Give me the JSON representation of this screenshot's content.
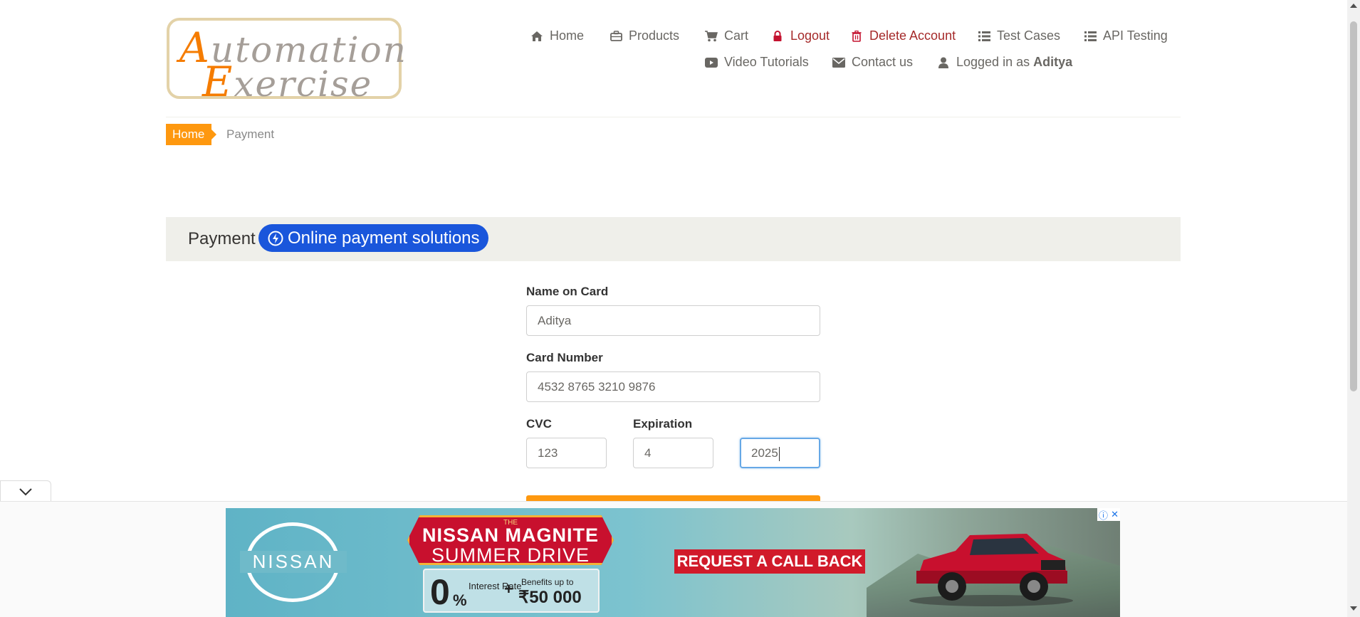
{
  "logo": {
    "line1_cap": "A",
    "line1_rest": "utomation",
    "line2_cap": "E",
    "line2_rest": "xercise"
  },
  "nav": {
    "items": [
      {
        "label": "Home",
        "icon": "home-icon"
      },
      {
        "label": "Products",
        "icon": "briefcase-icon"
      },
      {
        "label": "Cart",
        "icon": "cart-icon"
      },
      {
        "label": "Logout",
        "icon": "lock-icon"
      },
      {
        "label": "Delete Account",
        "icon": "trash-icon"
      },
      {
        "label": "Test Cases",
        "icon": "list-icon"
      },
      {
        "label": "API Testing",
        "icon": "list-icon"
      },
      {
        "label": "Video Tutorials",
        "icon": "youtube-icon"
      },
      {
        "label": "Contact us",
        "icon": "envelope-icon"
      }
    ],
    "logged_in_prefix": "Logged in as",
    "logged_in_user": "Aditya"
  },
  "breadcrumb": {
    "home": "Home",
    "current": "Payment"
  },
  "section": {
    "title": "Payment",
    "pill": "Online payment solutions"
  },
  "form": {
    "name_label": "Name on Card",
    "name_value": "Aditya",
    "card_label": "Card Number",
    "card_value": "4532 8765 3210 9876",
    "cvc_label": "CVC",
    "cvc_value": "123",
    "expiration_label": "Expiration",
    "exp_month_value": "4",
    "exp_year_value": "2025"
  },
  "ad": {
    "brand": "NISSAN",
    "title_small": "THE",
    "title_line1": "NISSAN MAGNITE",
    "title_line2": "SUMMER DRIVE",
    "offer_big": "0",
    "offer_pct": "%",
    "offer_rate": "Interest Rate",
    "offer_plus": "+",
    "offer_benefits": "Benefits up to",
    "offer_amount": "₹50 000",
    "cta": "REQUEST A CALL BACK"
  },
  "colors": {
    "accent_orange": "#fe980f",
    "danger_red": "#a52a2a",
    "pill_blue": "#1a56db"
  }
}
